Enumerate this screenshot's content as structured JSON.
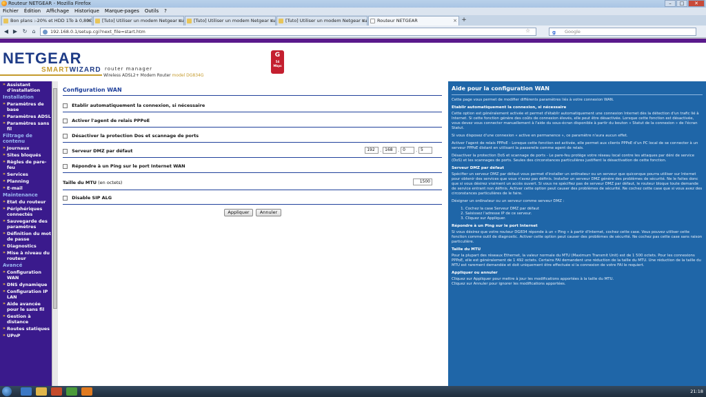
{
  "browser": {
    "window_title": "Routeur NETGEAR - Mozilla Firefox",
    "menu": [
      "Fichier",
      "Édition",
      "Affichage",
      "Historique",
      "Marque-pages",
      "Outils",
      "?"
    ],
    "tabs": [
      {
        "label": "Bon plans :-20% et HDD 1To à 0,80€ p..."
      },
      {
        "label": "[Tuto] Utiliser un modem Netgear sur..."
      },
      {
        "label": "[Tuto] Utiliser un modem Netgear sur..."
      },
      {
        "label": "[Tuto] Utiliser un modem Netgear sur..."
      },
      {
        "label": "Routeur NETGEAR"
      }
    ],
    "url": "192.168.0.1/setup.cgi?next_file=start.htm",
    "search_placeholder": "Google"
  },
  "header": {
    "brand": "NETGEAR",
    "smart": "SMART",
    "wizard": "WIZARD",
    "router_manager": "router manager",
    "desc": "Wireless ADSL2+ Modem Router",
    "model": "model DG834G",
    "badge_letter": "G",
    "badge_sub": "54 Mbps"
  },
  "nav": [
    {
      "type": "item",
      "label": "Assistant d'installation"
    },
    {
      "type": "section",
      "label": "Installation"
    },
    {
      "type": "item",
      "label": "Paramètres de base"
    },
    {
      "type": "item",
      "label": "Paramètres ADSL"
    },
    {
      "type": "item",
      "label": "Paramètres sans fil"
    },
    {
      "type": "section",
      "label": "Filtrage de contenu"
    },
    {
      "type": "item",
      "label": "Journaux"
    },
    {
      "type": "item",
      "label": "Sites bloqués"
    },
    {
      "type": "item",
      "label": "Règles de pare-feu"
    },
    {
      "type": "item",
      "label": "Services"
    },
    {
      "type": "item",
      "label": "Planning"
    },
    {
      "type": "item",
      "label": "E-mail"
    },
    {
      "type": "section",
      "label": "Maintenance"
    },
    {
      "type": "item",
      "label": "Etat du routeur"
    },
    {
      "type": "item",
      "label": "Périphériques connectés"
    },
    {
      "type": "item",
      "label": "Sauvegarde des paramètres"
    },
    {
      "type": "item",
      "label": "Définition du mot de passe"
    },
    {
      "type": "item",
      "label": "Diagnostics"
    },
    {
      "type": "item",
      "label": "Mise à niveau du routeur"
    },
    {
      "type": "section",
      "label": "Avancé"
    },
    {
      "type": "item",
      "label": "Configuration WAN"
    },
    {
      "type": "item",
      "label": "DNS dynamique"
    },
    {
      "type": "item",
      "label": "Configuration IP LAN"
    },
    {
      "type": "item",
      "label": "Aide avancée pour le sans fil"
    },
    {
      "type": "item",
      "label": "Gestion à distance"
    },
    {
      "type": "item",
      "label": "Routes statiques"
    },
    {
      "type": "item",
      "label": "UPnP"
    }
  ],
  "form": {
    "title": "Configuration WAN",
    "opt_connect": "Etablir automatiquement la connexion, si nécessaire",
    "opt_pppoe": "Activer l'agent de relais PPPoE",
    "opt_dos": "Désactiver la protection Dos et scannage de ports",
    "opt_dmz": "Serveur DMZ par défaut",
    "dmz_ip": [
      "192",
      "168",
      "0",
      "5"
    ],
    "opt_ping": "Répondre à un Ping sur le port Internet WAN",
    "mtu_label": "Taille du MTU",
    "mtu_unit": "(en octets)",
    "mtu_value": "1500",
    "opt_sip": "Disable SIP ALG",
    "apply": "Appliquer",
    "cancel": "Annuler"
  },
  "help": {
    "title": "Aide pour la configuration WAN",
    "intro": "Cette page vous permet de modifier différents paramètres liés à votre connexion WAN.",
    "h_connect": "Etablir automatiquement la connexion, si nécessaire",
    "p_connect": "Cette option est généralement activée et permet d'établir automatiquement une connexion Internet dès la détection d'un trafic lié à Internet. Si cette fonction génère des coûts de connexion élevés, elle peut être désactivée. Lorsque cette fonction est désactivée, vous devez vous connecter manuellement à l'aide du sous-écran disponible à partir du bouton « Statut de la connexion » de l'écran Statut.",
    "p_connect2": "Si vous disposez d'une connexion « active en permanence », ce paramètre n'aura aucun effet.",
    "p_pppoe": "Activer l'agent de relais PPPoE - Lorsque cette fonction est activée, elle permet aux clients PPPoE d'un PC local de se connecter à un serveur PPPoE distant en utilisant la passerelle comme agent de relais.",
    "p_dos": "Désactiver la protection DoS et scannage de ports - Le pare-feu protège votre réseau local contre les attaques par déni de service (DoS) et les scannages de ports. Seules des circonstances particulières justifient la désactivation de cette fonction.",
    "h_dmz": "Serveur DMZ par défaut",
    "p_dmz": "Spécifier un serveur DMZ par défaut vous permet d'installer un ordinateur ou un serveur que quiconque pourra utiliser sur Internet pour obtenir des services que vous n'avez pas définis. Installer un serveur DMZ génère des problèmes de sécurité. Ne le faites donc que si vous désirez vraiment un accès ouvert. Si vous ne spécifiez pas de serveur DMZ par défaut, le routeur bloque toute demande de service entrant non définis. Activer cette option peut causer des problèmes de sécurité. Ne cochez cette case que si vous avez des circonstances particulières de le faire.",
    "p_dmz2": "Désigner un ordinateur ou un serveur comme serveur DMZ :",
    "steps": [
      "Cochez la case Serveur DMZ par défaut",
      "Saisissez l'adresse IP de ce serveur.",
      "Cliquez sur Appliquer."
    ],
    "h_ping": "Répondre à un Ping sur le port Internet",
    "p_ping": "Si vous désirez que votre routeur DG834 réponde à un « Ping » à partir d'Internet, cochez cette case. Vous pouvez utiliser cette fonction comme outil de diagnostic. Activer cette option peut causer des problèmes de sécurité. Ne cochez pas cette case sans raison particulière.",
    "h_mtu": "Taille du MTU",
    "p_mtu": "Pour la plupart des réseaux Ethernet, la valeur normale du MTU (Maximum Transmit Unit) est de 1 500 octets. Pour les connexions PPPoE, elle est généralement de 1 492 octets. Certains FAI demandent une réduction de la taille du MTU. Une réduction de la taille du MTU est rarement demandée et doit uniquement être effectuée si la connexion de votre FAI le requiert.",
    "h_apply": "Appliquer ou annuler",
    "p_apply": "Cliquez sur Appliquer pour mettre à jour les modifications apportées à la taille du MTU.",
    "p_cancel": "Cliquez sur Annuler pour ignorer les modifications apportées."
  },
  "taskbar": {
    "clock": "21:18"
  }
}
